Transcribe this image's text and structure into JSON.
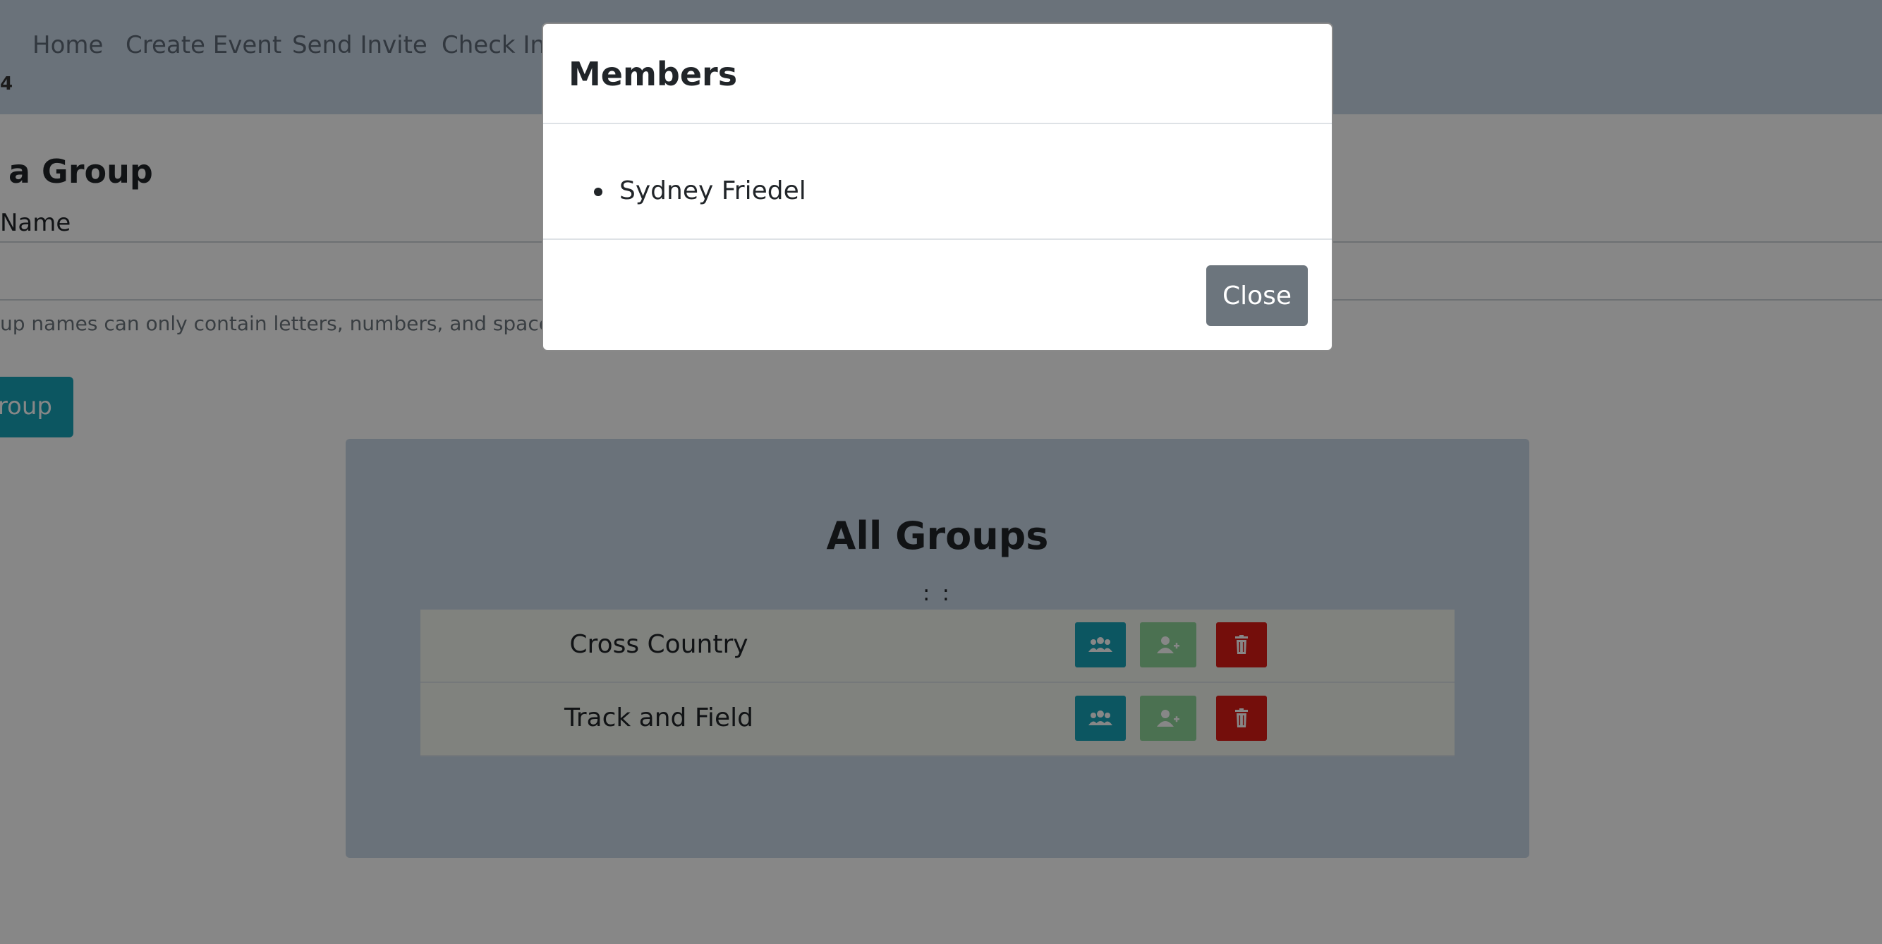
{
  "navbar": {
    "links": [
      "Home",
      "Create Event",
      "Send Invite",
      "Check In/"
    ],
    "sub_text": "4"
  },
  "create_group": {
    "title": "a Group",
    "field_label": "Name",
    "input_value": "",
    "help_text": "up names can only contain letters, numbers, and spaces",
    "button_label": "roup"
  },
  "groups": {
    "title": "All Groups",
    "separator": ": :",
    "rows": [
      {
        "name": "Cross Country"
      },
      {
        "name": "Track and Field"
      }
    ],
    "colors": {
      "members_button": "#17a2b8",
      "add_member_button": "#8fd59a",
      "delete_button": "#dc1c16"
    },
    "icons": [
      "users-icon",
      "user-plus-icon",
      "trash-icon"
    ]
  },
  "modal": {
    "title": "Members",
    "members": [
      "Sydney Friedel"
    ],
    "close_label": "Close"
  }
}
